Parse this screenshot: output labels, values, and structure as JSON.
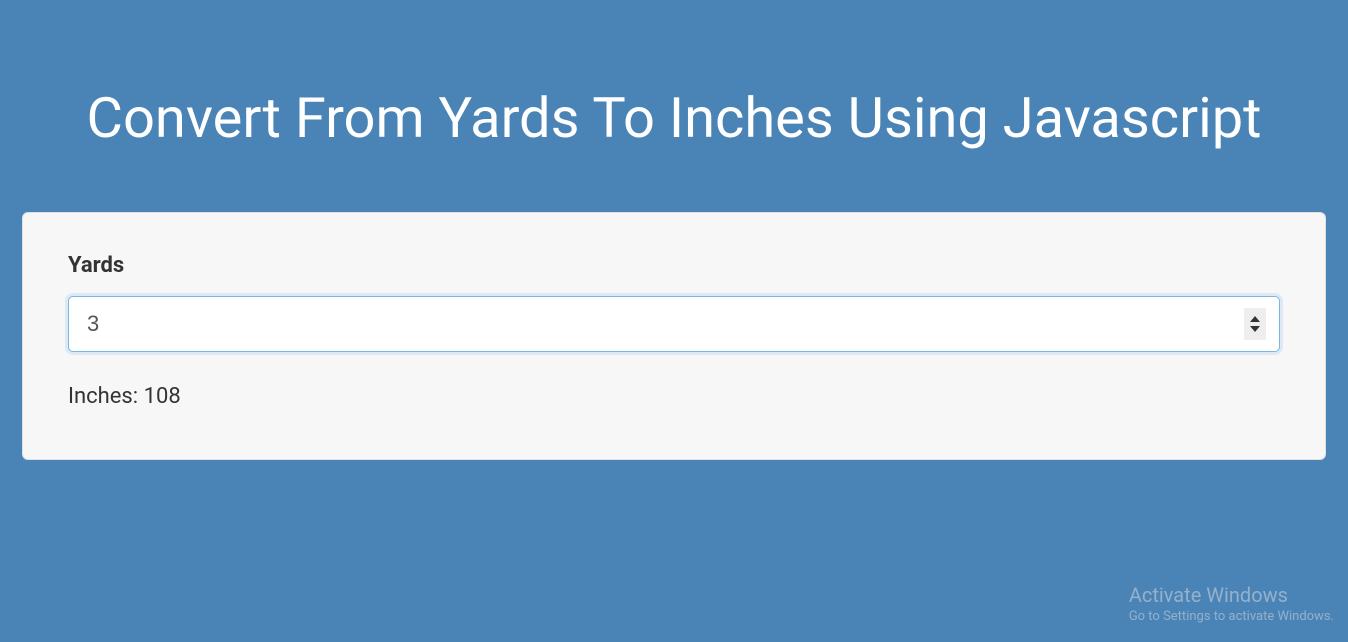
{
  "header": {
    "title": "Convert From Yards To Inches Using Javascript"
  },
  "form": {
    "label": "Yards",
    "input_value": "3",
    "result_label": "Inches:",
    "result_value": "108"
  },
  "watermark": {
    "title": "Activate Windows",
    "subtitle": "Go to Settings to activate Windows."
  }
}
